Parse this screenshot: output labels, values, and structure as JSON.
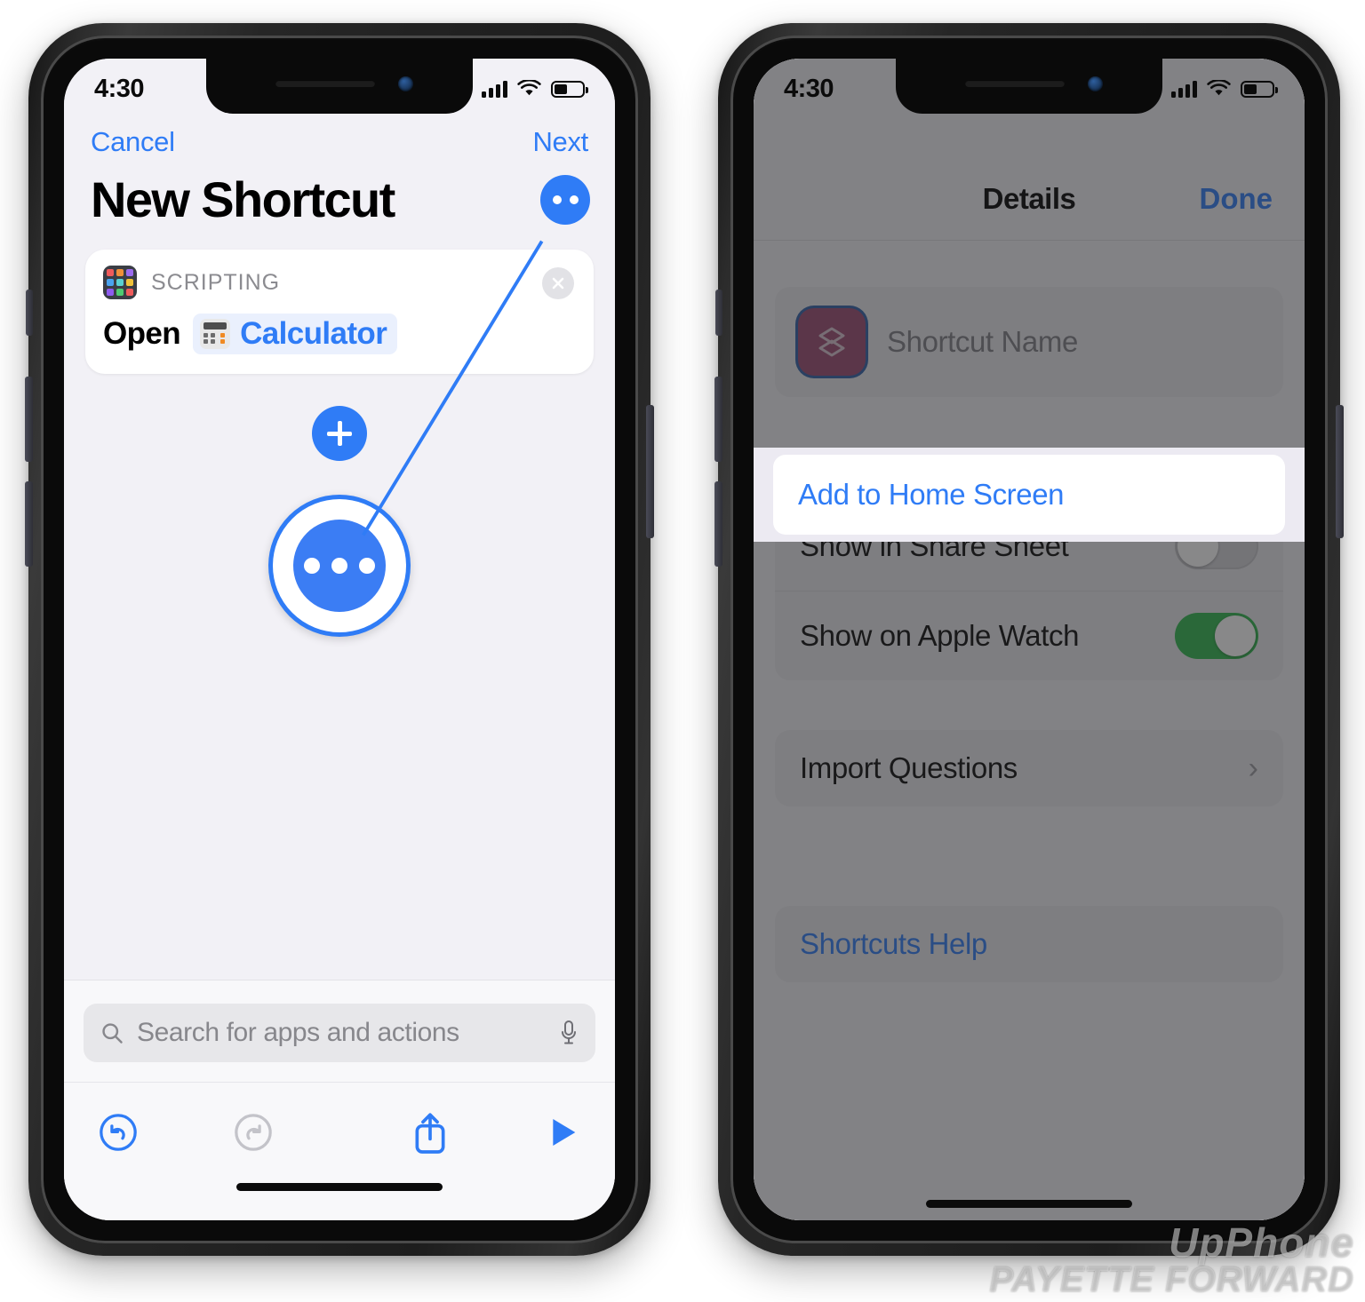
{
  "left_phone": {
    "status_bar": {
      "time": "4:30",
      "cellular_icon": "signal-bars-icon",
      "wifi_icon": "wifi-icon",
      "battery_icon": "battery-icon",
      "battery_level": "42"
    },
    "nav": {
      "cancel_label": "Cancel",
      "next_label": "Next"
    },
    "page_title": "New Shortcut",
    "more_button_label": "•••",
    "action_card": {
      "category": "SCRIPTING",
      "app_icon": "scripting-apps-grid-icon",
      "remove_icon": "close-circle-icon",
      "verb": "Open",
      "parameter_icon": "calculator-app-icon",
      "parameter": "Calculator"
    },
    "add_action_button": "+",
    "highlighted_more_button": {
      "label": "•••",
      "annotation": "callout-circle"
    },
    "search": {
      "placeholder": "Search for apps and actions",
      "search_icon": "search-icon",
      "mic_icon": "microphone-icon"
    },
    "toolbar": {
      "undo_icon": "undo-icon",
      "redo_icon": "redo-icon",
      "share_icon": "share-icon",
      "play_icon": "play-icon"
    }
  },
  "right_phone": {
    "status_bar": {
      "time": "4:30",
      "cellular_icon": "signal-bars-icon",
      "wifi_icon": "wifi-icon",
      "battery_icon": "battery-icon",
      "battery_level": "42"
    },
    "sheet": {
      "title": "Details",
      "done_label": "Done",
      "name_field": {
        "icon": "shortcut-layers-icon",
        "placeholder": "Shortcut Name",
        "value": ""
      },
      "highlighted_row": {
        "label": "Add to Home Screen"
      },
      "toggles": [
        {
          "label": "Show in Share Sheet",
          "state": "off"
        },
        {
          "label": "Show on Apple Watch",
          "state": "on"
        }
      ],
      "nav_rows": [
        {
          "label": "Import Questions",
          "accessory_icon": "chevron-right-icon"
        }
      ],
      "help_row": {
        "label": "Shortcuts Help"
      }
    }
  },
  "watermark": {
    "line1": "UpPhone",
    "line2": "PAYETTE FORWARD"
  },
  "colors": {
    "accent_blue": "#2f7cf6",
    "toggle_on_green": "#2fb94e",
    "shortcut_icon_magenta": "#9c4a72",
    "screen_bg": "#f2f1f6"
  }
}
